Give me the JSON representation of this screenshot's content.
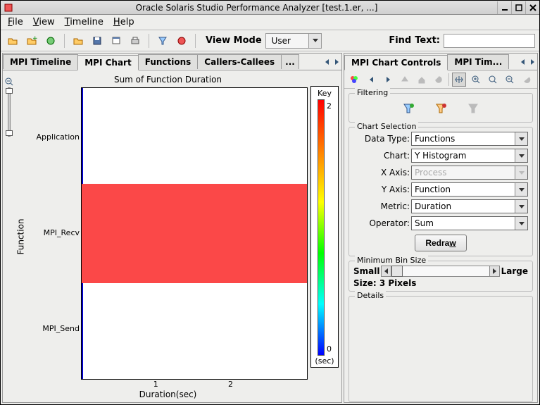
{
  "title": "Oracle Solaris Studio Performance Analyzer [test.1.er, ...]",
  "menus": [
    "File",
    "View",
    "Timeline",
    "Help"
  ],
  "viewmode_label": "View Mode",
  "viewmode_value": "User",
  "find_label": "Find",
  "find_text_label": "Text:",
  "left_tabs": {
    "items": [
      "MPI Timeline",
      "MPI Chart",
      "Functions",
      "Callers-Callees"
    ],
    "active": 1,
    "more": "..."
  },
  "right_tabs": {
    "items": [
      "MPI Chart Controls",
      "MPI Tim..."
    ],
    "active": 0
  },
  "chart": {
    "title": "Sum of Function Duration",
    "ylabel": "Function",
    "xlabel": "Duration(sec)",
    "yticks": [
      "Application",
      "MPI_Recv",
      "MPI_Send"
    ],
    "xticks": [
      "1",
      "2"
    ],
    "key": {
      "title": "Key",
      "max": "2",
      "min": "0",
      "unit": "(sec)"
    }
  },
  "right": {
    "filtering": "Filtering",
    "chart_selection": "Chart Selection",
    "fields": {
      "datatype": {
        "label": "Data Type:",
        "value": "Functions"
      },
      "chart": {
        "label": "Chart:",
        "value": "Y Histogram"
      },
      "xaxis": {
        "label": "X Axis:",
        "value": "Process"
      },
      "yaxis": {
        "label": "Y Axis:",
        "value": "Function"
      },
      "metric": {
        "label": "Metric:",
        "value": "Duration"
      },
      "operator": {
        "label": "Operator:",
        "value": "Sum"
      }
    },
    "redraw": "Redraw",
    "minbin": {
      "title": "Minimum Bin Size",
      "small": "Small",
      "large": "Large",
      "size": "Size: 3 Pixels"
    },
    "details": "Details"
  },
  "chart_data": {
    "type": "bar",
    "orientation": "horizontal",
    "categories": [
      "Application",
      "MPI_Recv",
      "MPI_Send"
    ],
    "values": [
      0.02,
      2.8,
      0.01
    ],
    "color_values": [
      2,
      2,
      0
    ],
    "xlabel": "Duration(sec)",
    "ylabel": "Function",
    "title": "Sum of Function Duration",
    "xlim": [
      0,
      3
    ],
    "colorbar": {
      "min": 0,
      "max": 2,
      "unit": "sec"
    }
  }
}
